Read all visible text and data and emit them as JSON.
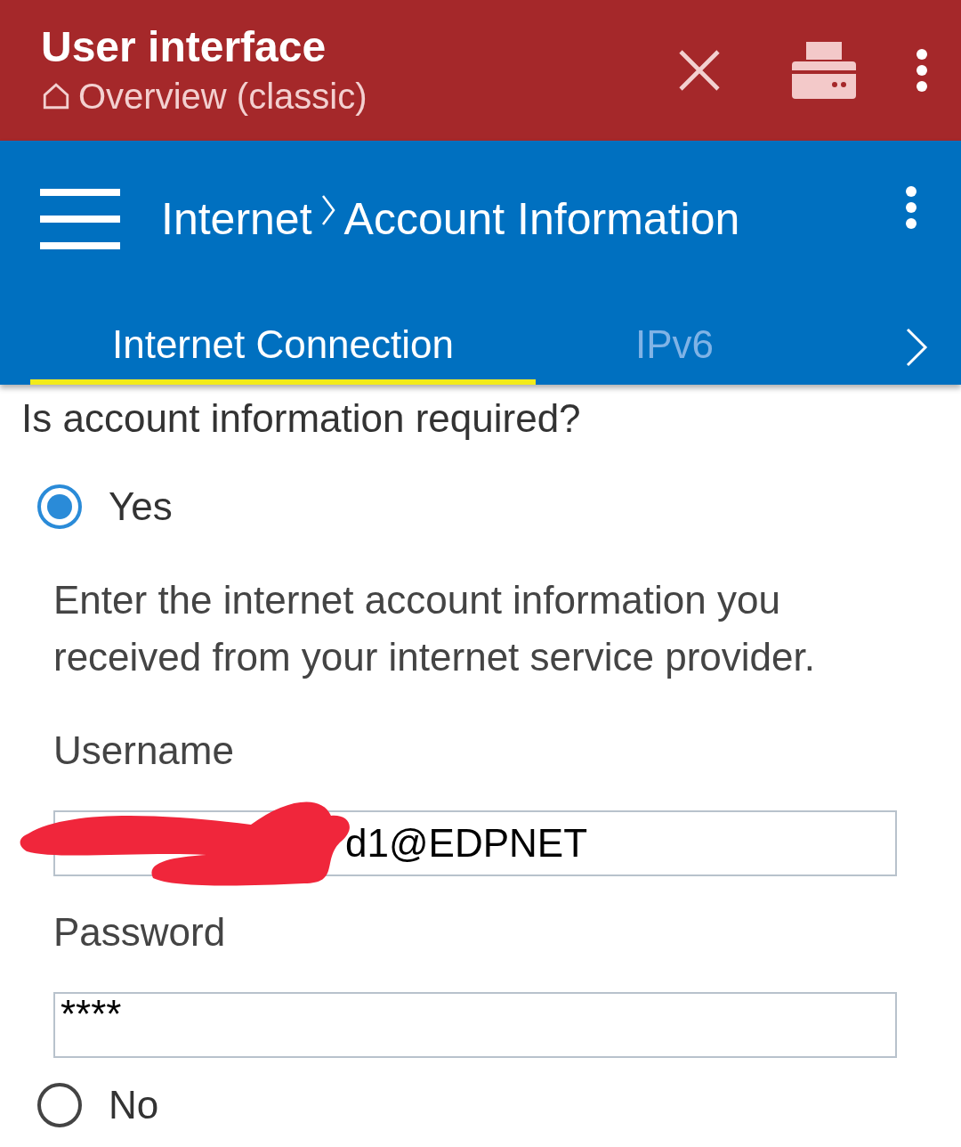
{
  "header": {
    "title": "User interface",
    "subtitle": "Overview (classic)"
  },
  "toolbar": {
    "breadcrumb": [
      "Internet",
      "Account Information"
    ]
  },
  "tabs": [
    {
      "label": "Internet Connection",
      "selected": true
    },
    {
      "label": "IPv6",
      "selected": false
    }
  ],
  "question": "Is account information required?",
  "options": [
    {
      "label": "Yes",
      "selected": true,
      "description": "Enter the internet account information you received from your internet service provider.",
      "fields": [
        {
          "label": "Username",
          "value": "d1@EDPNET",
          "redacted": true
        },
        {
          "label": "Password",
          "value": "****",
          "redacted": false
        }
      ]
    },
    {
      "label": "No",
      "selected": false
    }
  ]
}
